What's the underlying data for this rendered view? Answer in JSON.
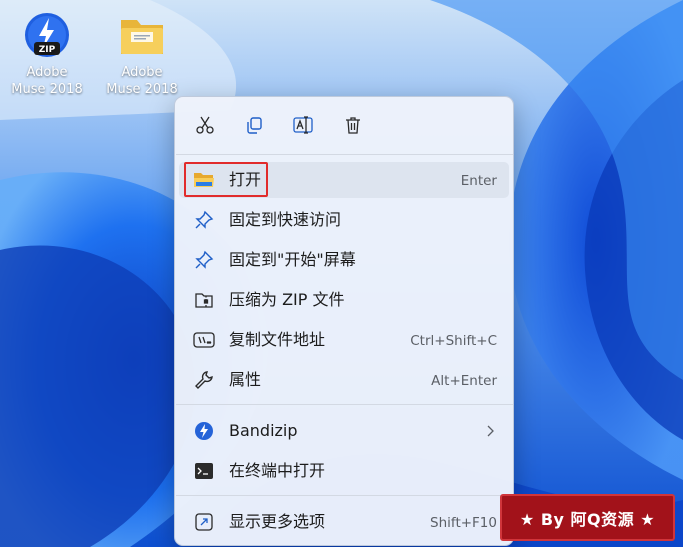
{
  "desktop": {
    "icons": [
      {
        "line1": "Adobe",
        "line2": "Muse 2018",
        "icon": "zip-archive-icon"
      },
      {
        "line1": "Adobe",
        "line2": "Muse 2018",
        "icon": "folder-icon"
      }
    ]
  },
  "context_menu": {
    "toolbar": [
      {
        "name": "cut",
        "icon": "scissors-icon"
      },
      {
        "name": "copy",
        "icon": "copy-icon"
      },
      {
        "name": "rename",
        "icon": "rename-icon"
      },
      {
        "name": "delete",
        "icon": "trash-icon"
      }
    ],
    "items": [
      {
        "label": "打开",
        "shortcut": "Enter",
        "icon": "folder-open-icon"
      },
      {
        "label": "固定到快速访问",
        "shortcut": "",
        "icon": "pin-icon"
      },
      {
        "label": "固定到\"开始\"屏幕",
        "shortcut": "",
        "icon": "pin-icon"
      },
      {
        "label": "压缩为 ZIP 文件",
        "shortcut": "",
        "icon": "zip-folder-icon"
      },
      {
        "label": "复制文件地址",
        "shortcut": "Ctrl+Shift+C",
        "icon": "copy-path-icon"
      },
      {
        "label": "属性",
        "shortcut": "Alt+Enter",
        "icon": "wrench-icon"
      },
      {
        "label": "Bandizip",
        "shortcut": "",
        "icon": "bandizip-icon",
        "submenu": true
      },
      {
        "label": "在终端中打开",
        "shortcut": "",
        "icon": "terminal-icon"
      },
      {
        "label": "显示更多选项",
        "shortcut": "Shift+F10",
        "icon": "more-options-icon"
      }
    ]
  },
  "watermark": {
    "text": "★ By 阿Q资源 ★"
  },
  "colors": {
    "accent": "#1d69e6",
    "highlight_border": "#e12b2b",
    "watermark_bg": "#a2121a"
  }
}
